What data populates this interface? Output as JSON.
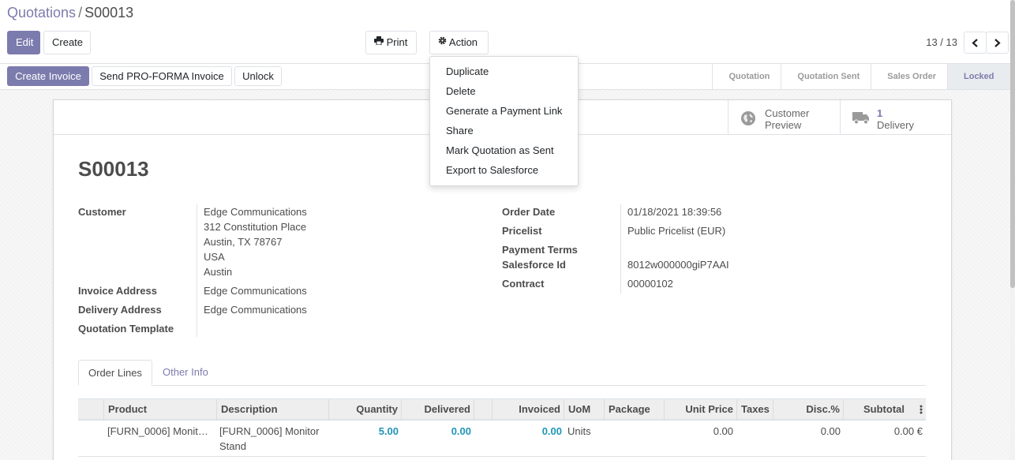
{
  "breadcrumb": {
    "parent": "Quotations",
    "separator": "/",
    "current": "S00013"
  },
  "toolbar": {
    "edit": "Edit",
    "create": "Create",
    "print": "Print",
    "action": "Action"
  },
  "pager": {
    "value": "13 / 13"
  },
  "header_buttons": {
    "create_invoice": "Create Invoice",
    "send_proforma": "Send PRO-FORMA Invoice",
    "unlock": "Unlock"
  },
  "stages": [
    "Quotation",
    "Quotation Sent",
    "Sales Order",
    "Locked"
  ],
  "stage_active": "Locked",
  "action_menu": [
    "Duplicate",
    "Delete",
    "Generate a Payment Link",
    "Share",
    "Mark Quotation as Sent",
    "Export to Salesforce"
  ],
  "smart_buttons": {
    "customer_preview": {
      "line1": "Customer",
      "line2": "Preview"
    },
    "delivery": {
      "count": "1",
      "label": "Delivery"
    }
  },
  "record": {
    "name": "S00013",
    "labels": {
      "customer": "Customer",
      "invoice_address": "Invoice Address",
      "delivery_address": "Delivery Address",
      "quotation_template": "Quotation Template",
      "order_date": "Order Date",
      "pricelist": "Pricelist",
      "payment_terms": "Payment Terms",
      "salesforce_id": "Salesforce Id",
      "contract": "Contract"
    },
    "customer_name": "Edge Communications",
    "customer_address": [
      "312 Constitution Place",
      "Austin, TX 78767",
      "USA",
      "Austin"
    ],
    "invoice_address": "Edge Communications",
    "delivery_address": "Edge Communications",
    "order_date": "01/18/2021 18:39:56",
    "pricelist": "Public Pricelist (EUR)",
    "salesforce_id": "8012w000000giP7AAI",
    "contract": "00000102"
  },
  "tabs": [
    "Order Lines",
    "Other Info"
  ],
  "order_lines": {
    "columns": [
      "Product",
      "Description",
      "Quantity",
      "Delivered",
      "Invoiced",
      "UoM",
      "Package",
      "Unit Price",
      "Taxes",
      "Disc.%",
      "Subtotal"
    ],
    "rows": [
      {
        "product": "[FURN_0006] Monit…",
        "description_1": "[FURN_0006] Monitor",
        "description_2": "Stand",
        "quantity": "5.00",
        "delivered": "0.00",
        "invoiced": "0.00",
        "uom": "Units",
        "unit_price": "0.00",
        "disc": "0.00",
        "subtotal": "0.00 €"
      }
    ]
  },
  "colors": {
    "accent": "#7c7bad",
    "qty_blue": "#1f95b6"
  }
}
